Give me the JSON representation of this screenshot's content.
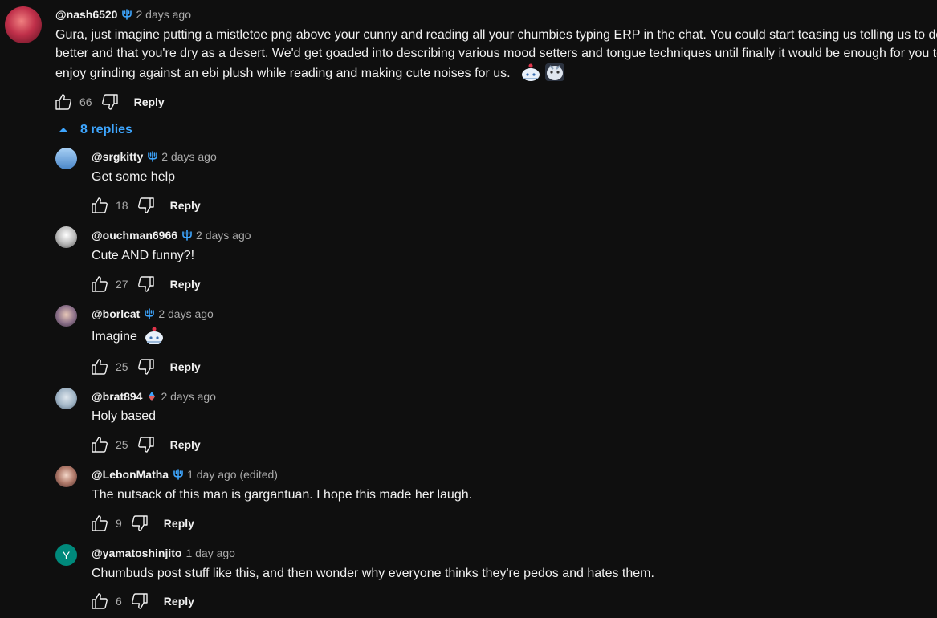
{
  "top_comment": {
    "author": "@nash6520",
    "time": "2 days ago",
    "lines": [
      "Gura, just imagine putting a mistletoe png above your cunny and reading all your chumbies typing ERP in the chat. You could start teasing us telling us to do",
      "better and that you're dry as a desert. We'd get goaded into describing various mood setters and tongue techniques until finally it would be enough for you to",
      "enjoy grinding against an ebi plush while reading and making cute noises for us."
    ],
    "likes": "66",
    "reply_label": "Reply"
  },
  "replies_toggle": {
    "label": "8 replies",
    "accent": "#3ea6ff"
  },
  "replies": [
    {
      "author": "@srgkitty",
      "time": "2 days ago",
      "text": "Get some help",
      "likes": "18",
      "reply_label": "Reply",
      "badge": "trident-icon",
      "avatar_color": "#7fb3e8"
    },
    {
      "author": "@ouchman6966",
      "time": "2 days ago",
      "text": "Cute AND funny?!",
      "likes": "27",
      "reply_label": "Reply",
      "badge": "trident-icon",
      "avatar_color": "#cccccc"
    },
    {
      "author": "@borlcat",
      "time": "2 days ago",
      "text": "Imagine",
      "likes": "25",
      "reply_label": "Reply",
      "badge": "trident-icon",
      "avatar_color": "#8a7a8f"
    },
    {
      "author": "@brat894",
      "time": "2 days ago",
      "text": "Holy based",
      "likes": "25",
      "reply_label": "Reply",
      "badge": "diamond-icon",
      "avatar_color": "#9fb3c4"
    },
    {
      "author": "@LebonMatha",
      "time": "1 day ago (edited)",
      "text": "The nutsack of this man is gargantuan. I hope this made her laugh.",
      "likes": "9",
      "reply_label": "Reply",
      "badge": "trident-icon",
      "avatar_color": "#b07a6a"
    },
    {
      "author": "@yamatoshinjito",
      "time": "1 day ago",
      "text": "Chumbuds post stuff like this, and then wonder why everyone thinks they're pedos and hates them.",
      "likes": "6",
      "reply_label": "Reply",
      "badge": "",
      "avatar_color": "#00897b",
      "avatar_letter": "Y"
    }
  ]
}
